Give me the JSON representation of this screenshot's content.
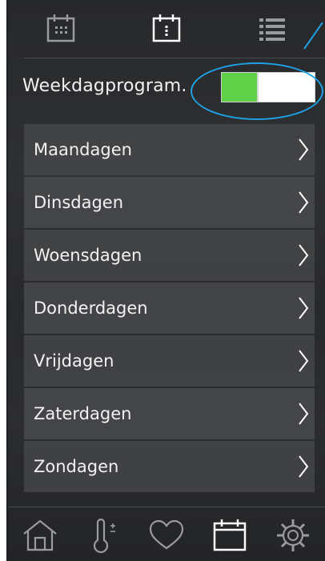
{
  "tabs": [
    {
      "icon": "calendar-grid-icon",
      "active": false
    },
    {
      "icon": "calendar-day-icon",
      "active": true
    },
    {
      "icon": "list-icon",
      "active": false
    }
  ],
  "program": {
    "label": "Weekdagprogram.",
    "toggle_level": 0.38,
    "toggle_color": "#5fd048"
  },
  "days": [
    {
      "label": "Maandagen"
    },
    {
      "label": "Dinsdagen"
    },
    {
      "label": "Woensdagen"
    },
    {
      "label": "Donderdagen"
    },
    {
      "label": "Vrijdagen"
    },
    {
      "label": "Zaterdagen"
    },
    {
      "label": "Zondagen"
    }
  ],
  "bottom_nav": [
    {
      "icon": "home-icon",
      "active": false
    },
    {
      "icon": "thermometer-icon",
      "active": false
    },
    {
      "icon": "heart-icon",
      "active": false
    },
    {
      "icon": "calendar-icon",
      "active": true
    },
    {
      "icon": "gear-icon",
      "active": false
    }
  ],
  "colors": {
    "accent": "#1ea1e6",
    "icon_inactive": "#9a9b9e",
    "icon_active": "#ffffff"
  }
}
